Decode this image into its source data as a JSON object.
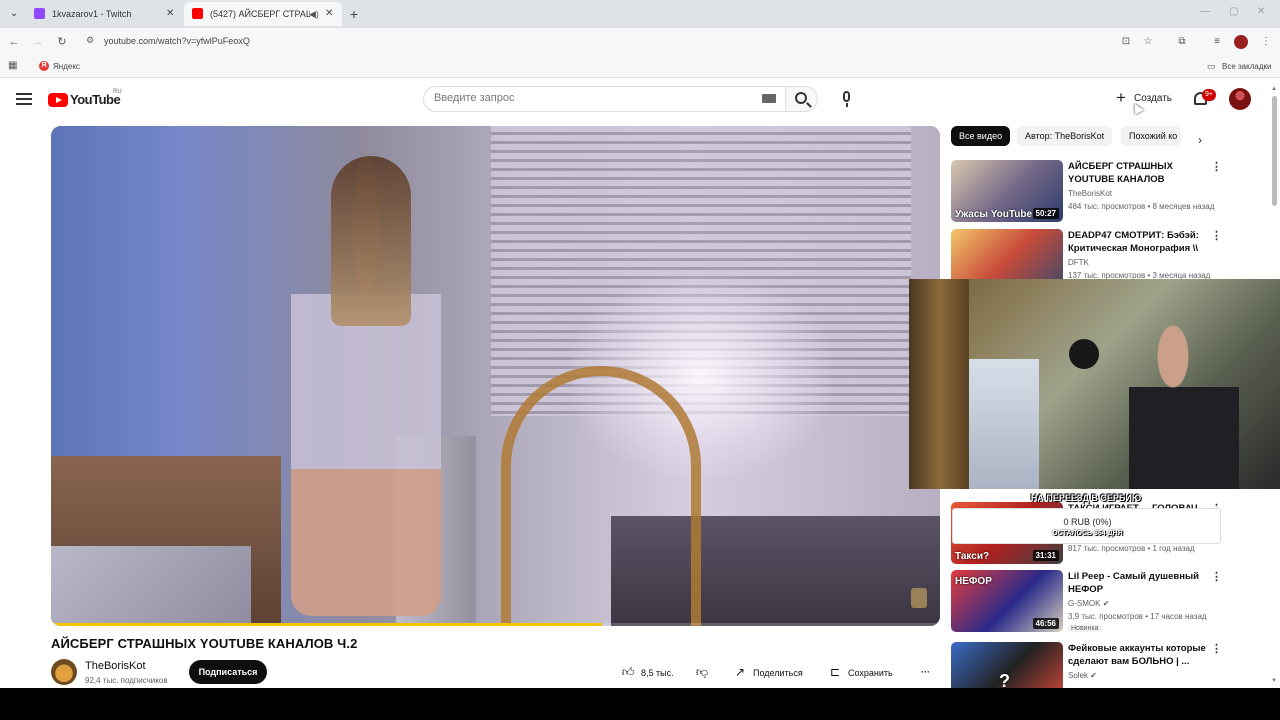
{
  "browser": {
    "tabs": [
      {
        "title": "1kvazarov1 - Twitch",
        "favicon_color": "#9146ff",
        "active": false
      },
      {
        "title": "(5427) АЙСБЕРГ СТРАШНЫ",
        "favicon_color": "#ff0000",
        "active": true
      }
    ],
    "url": "youtube.com/watch?v=yfwlPuFeoxQ",
    "bookmarks": [
      {
        "label": "Яндекс"
      }
    ],
    "all_bookmarks_label": "Все закладки"
  },
  "header": {
    "logo_text": "YouTube",
    "region": "RU",
    "search_placeholder": "Введите запрос",
    "create_label": "Создать",
    "notifications_badge": "9+"
  },
  "video": {
    "title": "АЙСБЕРГ СТРАШНЫХ YOUTUBE КАНАЛОВ Ч.2",
    "progress_fraction": 0.62,
    "channel": {
      "name": "TheBorisKot",
      "subscribers": "92,4 тыс. подписчиков"
    },
    "subscribe_label": "Подписаться",
    "likes": "8,5 тыс.",
    "share_label": "Поделиться",
    "save_label": "Сохранить"
  },
  "chips": [
    "Все видео",
    "Автор: TheBorisKot",
    "Похожий ко"
  ],
  "recommendations": [
    {
      "title": "АЙСБЕРГ СТРАШНЫХ YOUTUBE КАНАЛОВ",
      "channel": "TheBorisKot",
      "meta": "484 тыс. просмотров • 8 месяцев назад",
      "duration": "50:27",
      "thumb_text": "Ужасы YouTube"
    },
    {
      "title": "DEADP47 СМОТРИТ: Бэбэй: Критическая Монография \\\\ ...",
      "channel": "DFTK",
      "meta": "137 тыс. просмотров • 3 месяца назад",
      "duration": "",
      "thumb_text": ""
    },
    {
      "title": "ТАКСИ ИГРАЕТ ... ГОЛОВАЧ",
      "channel": "",
      "meta": "817 тыс. просмотров • 1 год назад",
      "duration": "31:31",
      "thumb_text": "Такси?"
    },
    {
      "title": "Lil Peep - Самый душевный НЕФОР",
      "channel": "G-SMOK",
      "meta": "3,9 тыс. просмотров • 17 часов назад",
      "duration": "46:56",
      "thumb_text": "НЕФОР",
      "badge": "Новинка"
    },
    {
      "title": "Фейковые аккаунты которые сделают вам БОЛЬНО | ...",
      "channel": "Solek",
      "meta": "",
      "duration": "",
      "thumb_text": "?"
    }
  ],
  "overlay": {
    "goal_title": "НА ПЕРЕЕЗД В СЕРБИЮ",
    "goal_amount": "0 RUB (0%)",
    "goal_remaining": "ОСТАЛОСЬ 364 ДНЯ"
  }
}
